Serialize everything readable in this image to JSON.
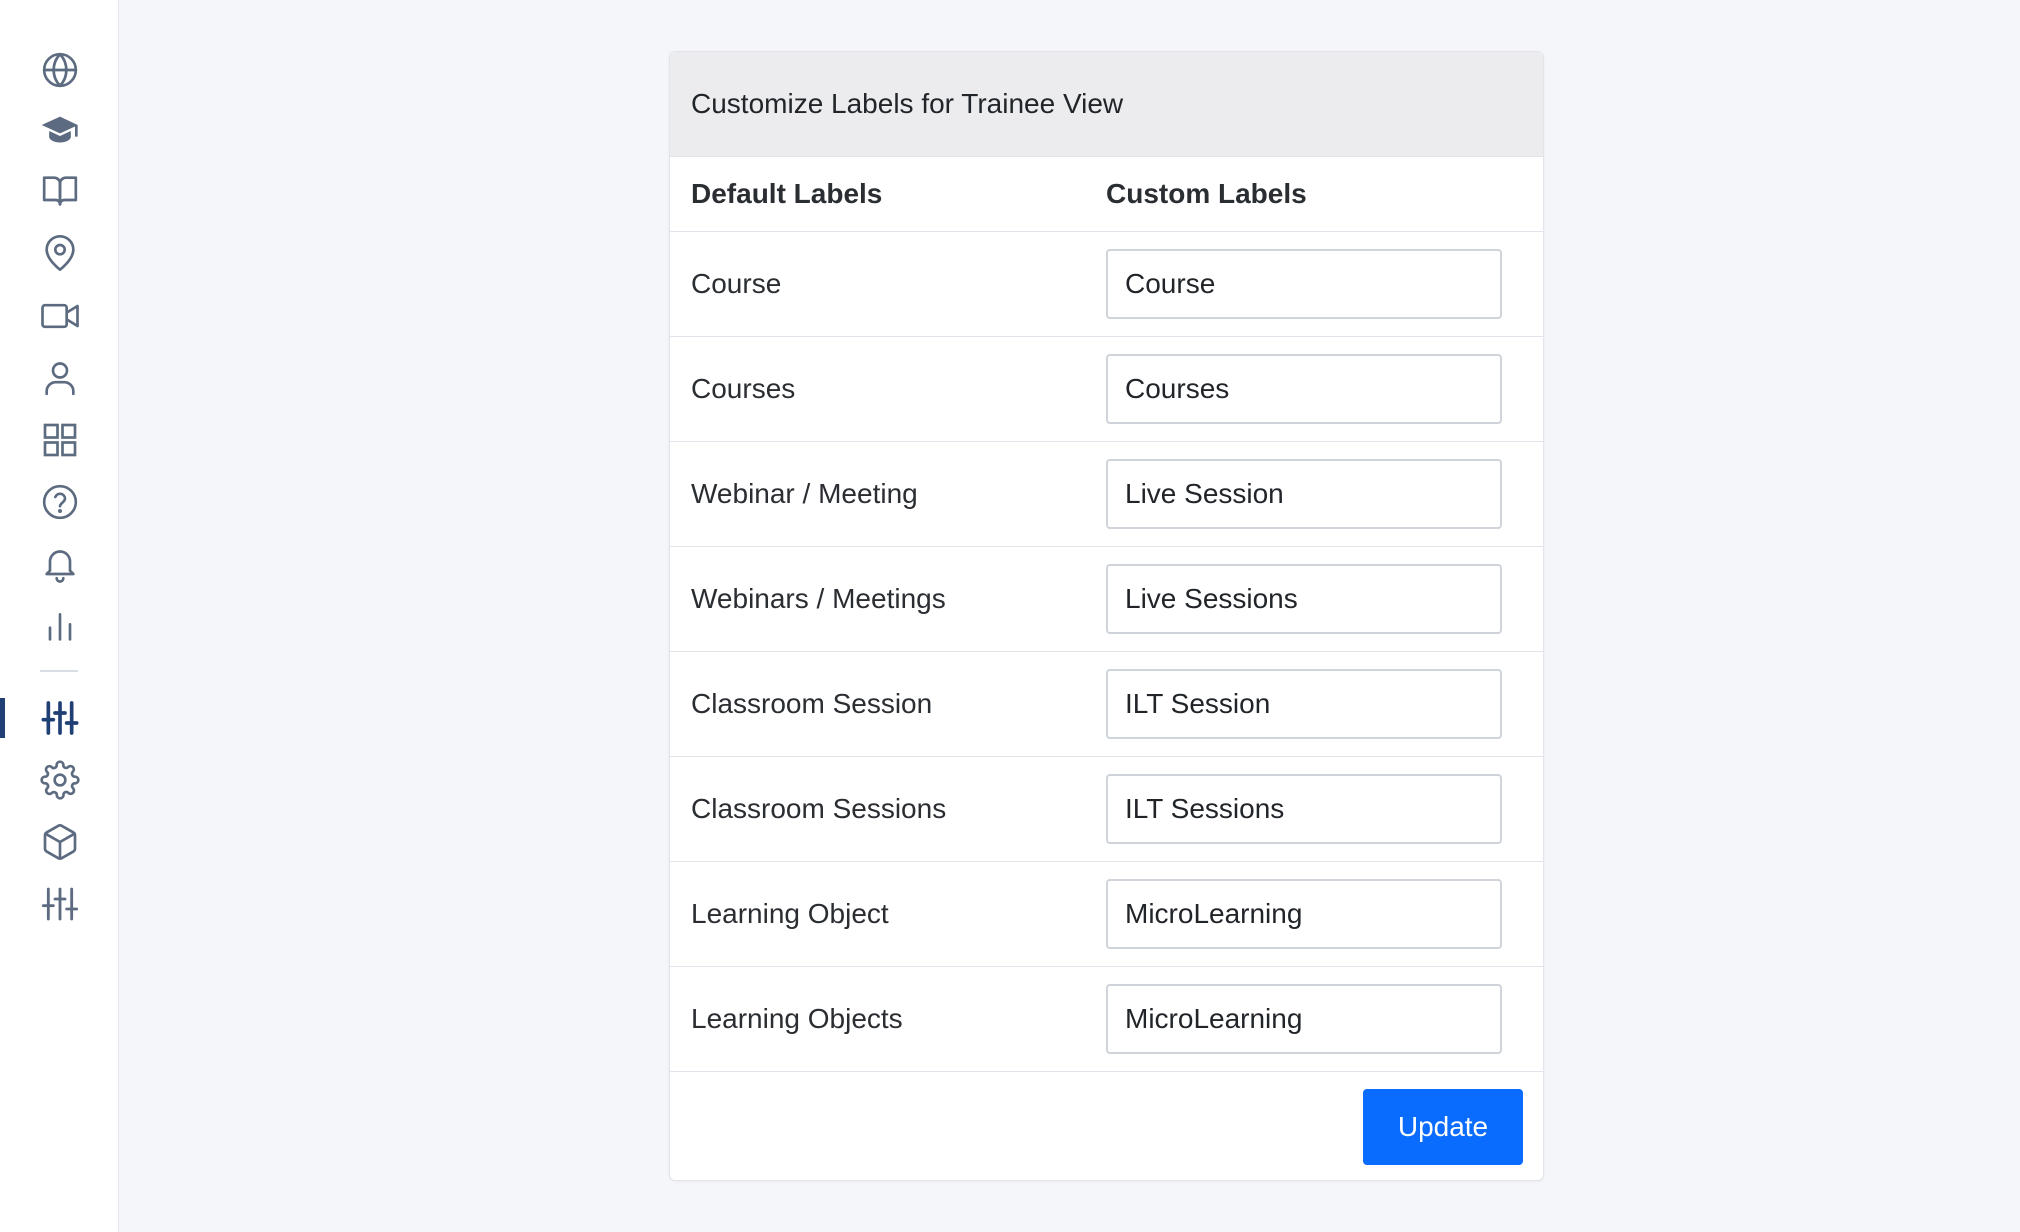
{
  "sidebar": {
    "icon_color": "#5c6b80",
    "active_color": "#1f3f75",
    "items": [
      {
        "icon": "globe-icon"
      },
      {
        "icon": "graduation-cap-icon"
      },
      {
        "icon": "book-open-icon"
      },
      {
        "icon": "map-pin-icon"
      },
      {
        "icon": "video-camera-icon"
      },
      {
        "icon": "user-icon"
      },
      {
        "icon": "grid-icon"
      },
      {
        "icon": "help-circle-icon"
      },
      {
        "icon": "bell-icon"
      },
      {
        "icon": "bar-chart-icon"
      },
      {
        "icon": "sliders-icon",
        "active": true
      },
      {
        "icon": "gear-icon"
      },
      {
        "icon": "box-icon"
      },
      {
        "icon": "sliders-icon"
      }
    ]
  },
  "card": {
    "title": "Customize Labels for Trainee View",
    "header_default": "Default Labels",
    "header_custom": "Custom Labels",
    "rows": [
      {
        "default": "Course",
        "custom": "Course"
      },
      {
        "default": "Courses",
        "custom": "Courses"
      },
      {
        "default": "Webinar / Meeting",
        "custom": "Live Session"
      },
      {
        "default": "Webinars / Meetings",
        "custom": "Live Sessions"
      },
      {
        "default": "Classroom Session",
        "custom": "ILT Session"
      },
      {
        "default": "Classroom Sessions",
        "custom": "ILT Sessions"
      },
      {
        "default": "Learning Object",
        "custom": "MicroLearning"
      },
      {
        "default": "Learning Objects",
        "custom": "MicroLearning"
      }
    ],
    "update_label": "Update",
    "accent_color": "#0a6cff"
  }
}
